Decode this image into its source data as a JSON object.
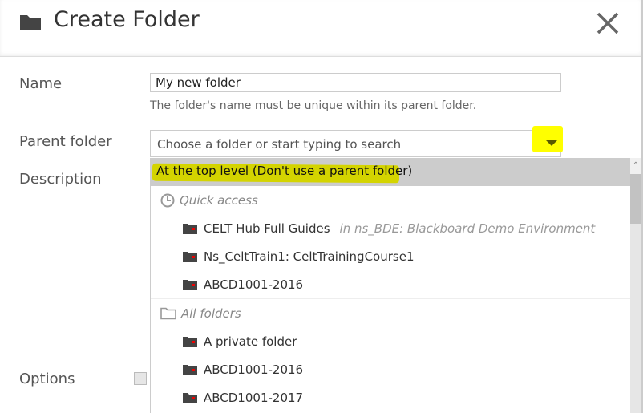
{
  "dialog": {
    "title": "Create Folder",
    "title_icon": "folder-icon",
    "close_icon": "close-icon"
  },
  "form": {
    "name_label": "Name",
    "name_value": "My new folder",
    "name_help": "The folder's name must be unique within its parent folder.",
    "parent_label": "Parent folder",
    "parent_placeholder": "Choose a folder or start typing to search",
    "description_label": "Description",
    "options_label": "Options"
  },
  "dropdown": {
    "top_option": "At the top level (Don't use a parent folder)",
    "highlight_color": "#ffff00",
    "quick_access_label": "Quick access",
    "quick_access": [
      {
        "label": "CELT Hub Full Guides",
        "context": "in ns_BDE: Blackboard Demo Environment"
      },
      {
        "label": "Ns_CeltTrain1: CeltTrainingCourse1",
        "context": ""
      },
      {
        "label": "ABCD1001-2016",
        "context": ""
      }
    ],
    "all_folders_label": "All folders",
    "all_folders": [
      {
        "label": "A private folder"
      },
      {
        "label": "ABCD1001-2016"
      },
      {
        "label": "ABCD1001-2017"
      }
    ]
  }
}
